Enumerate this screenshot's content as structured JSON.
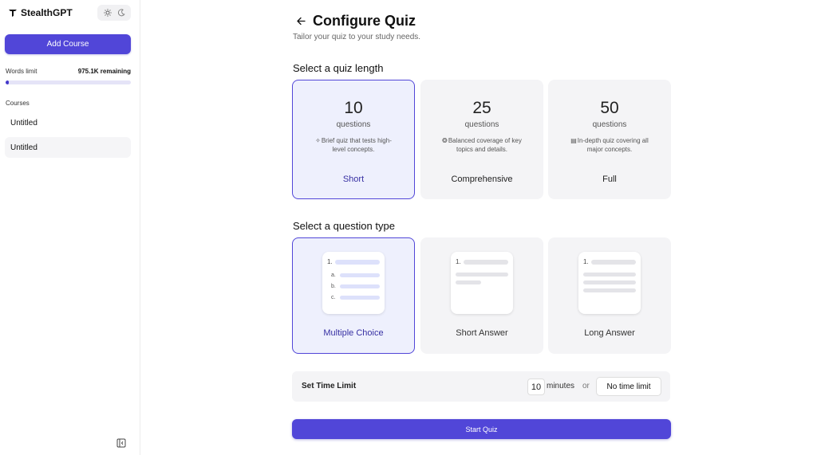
{
  "sidebar": {
    "brand": "StealthGPT",
    "add_course_label": "Add Course",
    "words_limit_label": "Words limit",
    "words_remaining": "975.1K remaining",
    "words_used_fraction": 0.025,
    "courses_label": "Courses",
    "courses": [
      {
        "label": "Untitled"
      },
      {
        "label": "Untitled"
      }
    ]
  },
  "main": {
    "title": "Configure Quiz",
    "subtitle": "Tailor your quiz to your study needs.",
    "length_section_title": "Select a quiz length",
    "length_options": [
      {
        "number": "10",
        "unit": "questions",
        "icon": "✧",
        "description": "Brief quiz that tests high-level concepts.",
        "name": "Short",
        "selected": true
      },
      {
        "number": "25",
        "unit": "questions",
        "icon": "❂",
        "description": "Balanced coverage of key topics and details.",
        "name": "Comprehensive",
        "selected": false
      },
      {
        "number": "50",
        "unit": "questions",
        "icon": "▤",
        "description": "In-depth quiz covering all major concepts.",
        "name": "Full",
        "selected": false
      }
    ],
    "type_section_title": "Select a question type",
    "type_options": [
      {
        "name": "Multiple Choice",
        "preview_number": "1.",
        "preview_options": [
          "a.",
          "b.",
          "c."
        ],
        "selected": true
      },
      {
        "name": "Short Answer",
        "preview_number": "1.",
        "selected": false
      },
      {
        "name": "Long Answer",
        "preview_number": "1.",
        "selected": false
      }
    ],
    "time_limit": {
      "label": "Set Time Limit",
      "value": "10",
      "unit": "minutes",
      "or": "or",
      "no_limit_label": "No time limit"
    },
    "start_label": "Start Quiz"
  },
  "colors": {
    "accent": "#5146d8",
    "selected_bg": "#eef0fd",
    "card_bg": "#f4f4f6"
  }
}
